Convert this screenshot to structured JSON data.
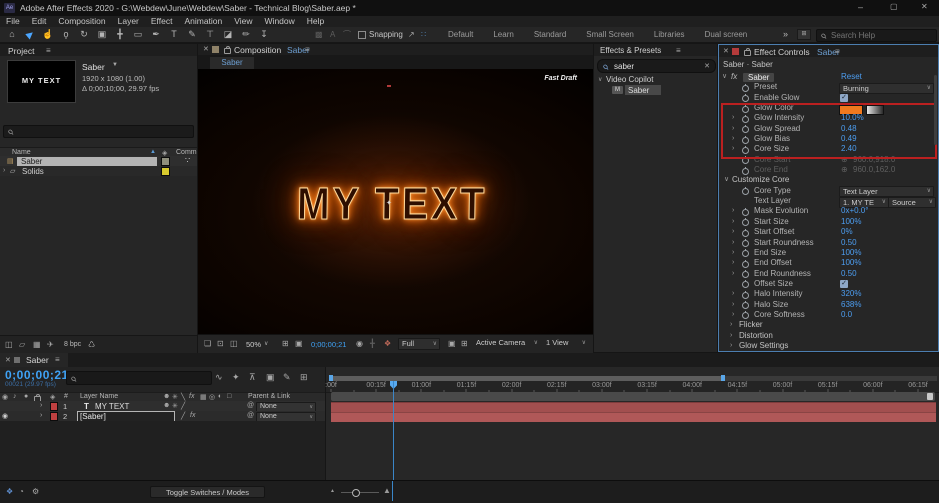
{
  "titlebar": {
    "app_badge": "Ae",
    "title": "Adobe After Effects 2020 - G:\\Webdew\\June\\Webdew\\Saber - Technical Blog\\Saber.aep *"
  },
  "menu": {
    "items": [
      "File",
      "Edit",
      "Composition",
      "Layer",
      "Effect",
      "Animation",
      "View",
      "Window",
      "Help"
    ]
  },
  "toolbar": {
    "tools": [
      {
        "name": "home-tool",
        "glyph": "⌂"
      },
      {
        "name": "selection-tool",
        "glyph": "▶",
        "active": true
      },
      {
        "name": "hand-tool",
        "glyph": "☝"
      },
      {
        "name": "zoom-tool",
        "glyph": "ϙ"
      },
      {
        "name": "rotation-tool",
        "glyph": "↻"
      },
      {
        "name": "camera-tool",
        "glyph": "▣"
      },
      {
        "name": "pan-behind-tool",
        "glyph": "╋"
      },
      {
        "name": "shape-tool",
        "glyph": "▭"
      },
      {
        "name": "pen-tool",
        "glyph": "✒"
      },
      {
        "name": "type-tool",
        "glyph": "T"
      },
      {
        "name": "brush-tool",
        "glyph": "✎"
      },
      {
        "name": "clone-stamp-tool",
        "glyph": "⊤"
      },
      {
        "name": "eraser-tool",
        "glyph": "◪"
      },
      {
        "name": "roto-brush-tool",
        "glyph": "✏"
      },
      {
        "name": "puppet-pin-tool",
        "glyph": "↧"
      }
    ],
    "snapping_label": "Snapping",
    "workspaces": [
      "Default",
      "Learn",
      "Standard",
      "Small Screen",
      "Libraries",
      "Dual screen"
    ],
    "overflow": "»",
    "search_placeholder": "Search Help"
  },
  "project": {
    "tab": "Project",
    "preview_text": "MY TEXT",
    "item_name": "Saber",
    "item_dims": "1920 x 1080 (1.00)",
    "item_duration": "Δ 0;00;10;00, 29.97 fps",
    "col_name": "Name",
    "col_comment": "Comm",
    "rows": [
      {
        "name": "Saber"
      },
      {
        "name": "Solids"
      }
    ],
    "footer_depth": "8 bpc"
  },
  "composition": {
    "tab_label": "Composition",
    "tab_comp": "Saber",
    "sub_tab": "Saber",
    "overlay_label": "Fast Draft",
    "canvas_text": "MY TEXT",
    "zoom": "50%",
    "timecode": "0;00;00;21",
    "resolution": "Full",
    "camera": "Active Camera",
    "view": "1 View"
  },
  "effects_presets": {
    "tab": "Effects & Presets",
    "search_value": "saber",
    "group": "Video Copilot",
    "item": "Saber"
  },
  "effect_controls": {
    "tab": "Effect Controls",
    "tab_comp": "Saber",
    "breadcrumb": "Saber · Saber",
    "accent_value_color": "#4c9df0",
    "glow_swatch_color": "#f0791e",
    "annotation_color": "#bb2020",
    "rows": [
      {
        "kind": "effect-header",
        "label": "Saber",
        "value": "Reset"
      },
      {
        "kind": "dropdown",
        "label": "Preset",
        "value": "Burning",
        "stopwatch": true
      },
      {
        "kind": "checkbox",
        "label": "Enable Glow",
        "checked": true,
        "stopwatch": true
      },
      {
        "kind": "color",
        "label": "Glow Color",
        "stopwatch": true
      },
      {
        "kind": "value",
        "label": "Glow Intensity",
        "value": "10.0%",
        "expander": true,
        "stopwatch": true
      },
      {
        "kind": "value",
        "label": "Glow Spread",
        "value": "0.48",
        "expander": true,
        "stopwatch": true
      },
      {
        "kind": "value",
        "label": "Glow Bias",
        "value": "0.49",
        "expander": true,
        "stopwatch": true
      },
      {
        "kind": "value",
        "label": "Core Size",
        "value": "2.40",
        "expander": true,
        "stopwatch": true
      },
      {
        "kind": "point-disabled",
        "label": "Core Start",
        "value": "960.0,918.0",
        "stopwatch": true
      },
      {
        "kind": "point-disabled",
        "label": "Core End",
        "value": "960.0,162.0",
        "stopwatch": true
      },
      {
        "kind": "group-open",
        "label": "Customize Core"
      },
      {
        "kind": "dropdown",
        "label": "Core Type",
        "value": "Text Layer",
        "stopwatch": true
      },
      {
        "kind": "dropdown2",
        "label": "Text Layer",
        "value": "1. MY TE",
        "value2": "Source"
      },
      {
        "kind": "value",
        "label": "Mask Evolution",
        "value": "0x+0.0°",
        "expander": true,
        "stopwatch": true
      },
      {
        "kind": "value",
        "label": "Start Size",
        "value": "100%",
        "expander": true,
        "stopwatch": true
      },
      {
        "kind": "value",
        "label": "Start Offset",
        "value": "0%",
        "expander": true,
        "stopwatch": true
      },
      {
        "kind": "value",
        "label": "Start Roundness",
        "value": "0.50",
        "expander": true,
        "stopwatch": true
      },
      {
        "kind": "value",
        "label": "End Size",
        "value": "100%",
        "expander": true,
        "stopwatch": true
      },
      {
        "kind": "value",
        "label": "End Offset",
        "value": "100%",
        "expander": true,
        "stopwatch": true
      },
      {
        "kind": "value",
        "label": "End Roundness",
        "value": "0.50",
        "expander": true,
        "stopwatch": true
      },
      {
        "kind": "checkbox",
        "label": "Offset Size",
        "checked": true,
        "stopwatch": true
      },
      {
        "kind": "value",
        "label": "Halo Intensity",
        "value": "320%",
        "expander": true,
        "stopwatch": true
      },
      {
        "kind": "value",
        "label": "Halo Size",
        "value": "638%",
        "expander": true,
        "stopwatch": true
      },
      {
        "kind": "value",
        "label": "Core Softness",
        "value": "0.0",
        "expander": true,
        "stopwatch": true
      },
      {
        "kind": "group-closed",
        "label": "Flicker"
      },
      {
        "kind": "group-closed",
        "label": "Distortion"
      },
      {
        "kind": "group-closed",
        "label": "Glow Settings"
      }
    ]
  },
  "timeline": {
    "tab": "Saber",
    "timecode": "0;00;00;21",
    "timecode_sub": "00021 (29.97 fps)",
    "col_hash": "#",
    "col_layer_name": "Layer Name",
    "col_parent": "Parent & Link",
    "layers": [
      {
        "num": "1",
        "type_badge": "T",
        "name": "MY TEXT",
        "parent": "None"
      },
      {
        "num": "2",
        "type_badge": "",
        "name": "[Saber]",
        "parent": "None",
        "editing": true
      }
    ],
    "ruler_ticks": [
      ":00f",
      "00:15f",
      "01:00f",
      "01:15f",
      "02:00f",
      "02:15f",
      "03:00f",
      "03:15f",
      "04:00f",
      "04:15f",
      "05:00f",
      "05:15f",
      "06:00f",
      "06:15f"
    ],
    "footer_button": "Toggle Switches / Modes"
  }
}
